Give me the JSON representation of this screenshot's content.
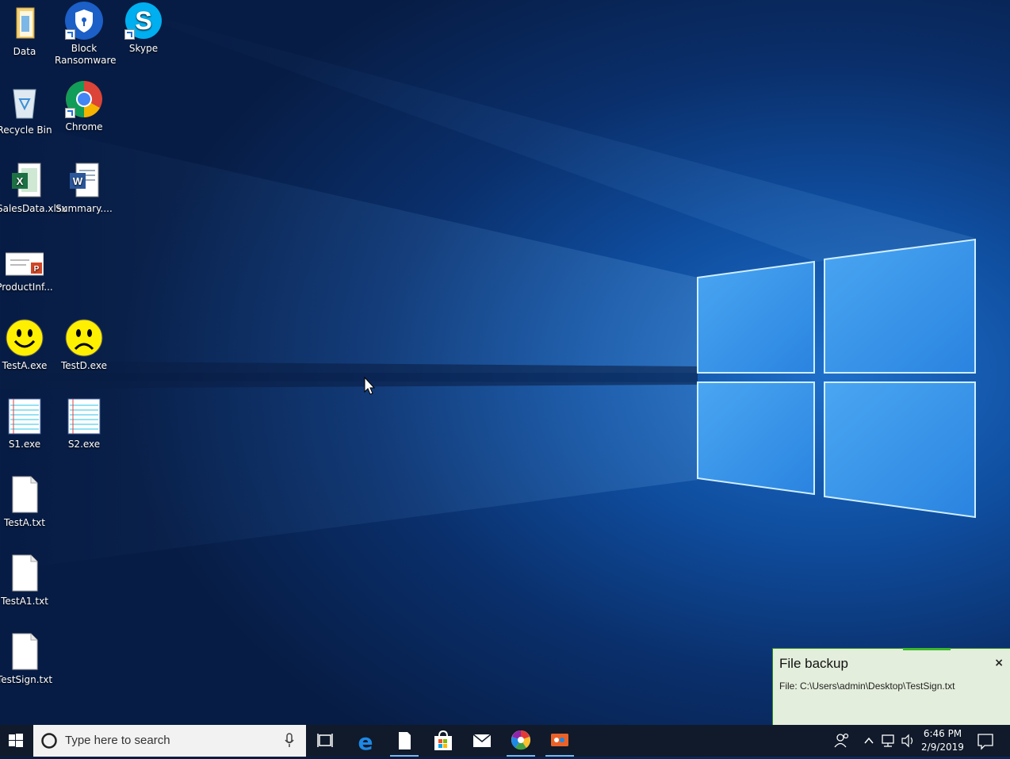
{
  "desktop": {
    "icons": [
      {
        "label": "Data",
        "icon": "folder-icon"
      },
      {
        "label": "Block Ransomware",
        "line1": "Block",
        "line2": "Ransomware",
        "icon": "shield-icon"
      },
      {
        "label": "Skype",
        "icon": "skype-icon"
      },
      {
        "label": "Recycle Bin",
        "icon": "recycle-bin-icon"
      },
      {
        "label": "Chrome",
        "icon": "chrome-icon"
      },
      {
        "label": "SalesData.xlsx",
        "icon": "excel-icon"
      },
      {
        "label": "Summary....",
        "icon": "word-icon"
      },
      {
        "label": "ProductInf...",
        "icon": "powerpoint-icon"
      },
      {
        "label": "TestA.exe",
        "icon": "smiley-icon"
      },
      {
        "label": "TestD.exe",
        "icon": "sad-face-icon"
      },
      {
        "label": "S1.exe",
        "icon": "notepad-exe-icon"
      },
      {
        "label": "S2.exe",
        "icon": "notepad-exe-icon"
      },
      {
        "label": "TestA.txt",
        "icon": "text-file-icon"
      },
      {
        "label": "TestA1.txt",
        "icon": "text-file-icon"
      },
      {
        "label": "TestSign.txt",
        "icon": "text-file-icon"
      }
    ]
  },
  "taskbar": {
    "search_placeholder": "Type here to search",
    "apps": [
      "task-view-icon",
      "edge-icon",
      "file-icon",
      "store-icon",
      "mail-icon",
      "photos-icon",
      "paint-icon"
    ],
    "time": "6:46 PM",
    "date": "2/9/2019"
  },
  "notification": {
    "title": "File backup",
    "close": "×",
    "message": "File: C:\\Users\\admin\\Desktop\\TestSign.txt"
  },
  "colors": {
    "taskbar": "#101a2a",
    "toast_bg": "#e4eedc",
    "toast_border": "#2b8a1e",
    "accent": "#79b8f0"
  }
}
